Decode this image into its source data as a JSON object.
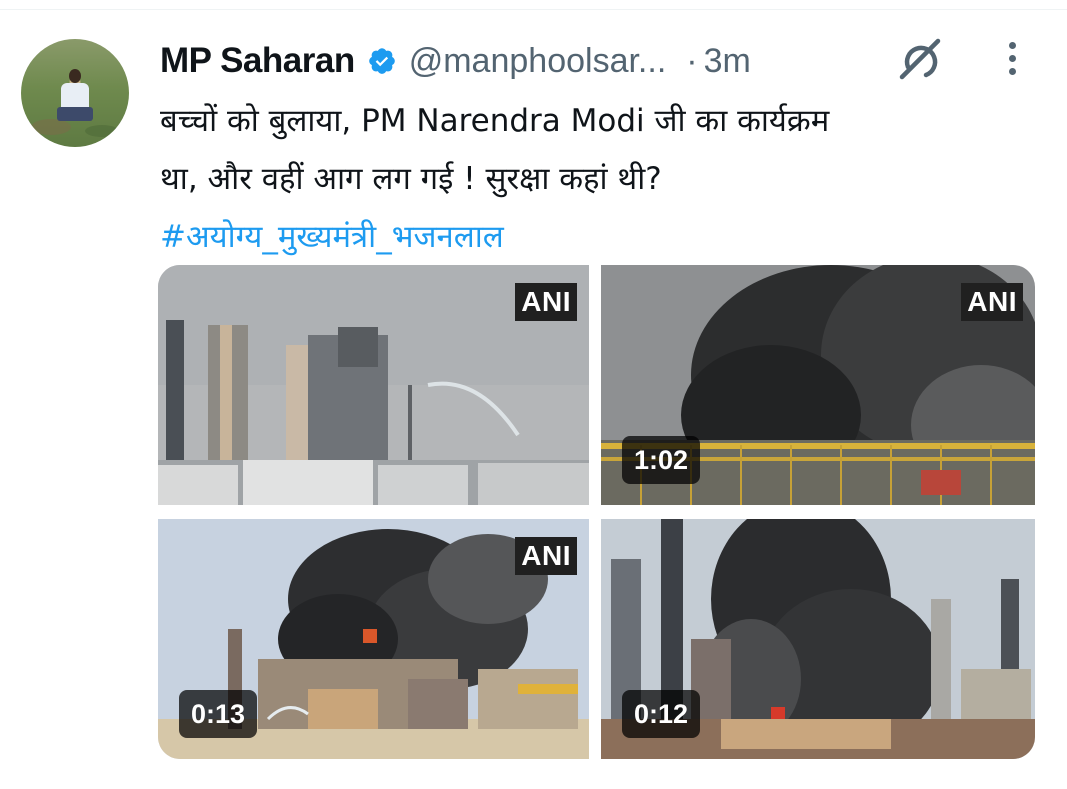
{
  "tweet": {
    "author_name": "MP Saharan",
    "handle": "@manphoolsar...",
    "separator": "·",
    "time": "3m",
    "text_line1": "बच्चों को बुलाया, PM Narendra Modi जी का कार्यक्रम",
    "text_line2": "था, और वहीं आग लग गई !   सुरक्षा कहां थी?",
    "hashtag": "#अयोग्य_मुख्यमंत्री_भजनलाल"
  },
  "icons": {
    "verified": "verified-badge-icon",
    "grok": "grok-icon",
    "more": "more-options-icon"
  },
  "media": [
    {
      "watermark": "ANI",
      "duration": ""
    },
    {
      "watermark": "ANI",
      "duration": "1:02"
    },
    {
      "watermark": "ANI",
      "duration": "0:13"
    },
    {
      "watermark": "",
      "duration": "0:12"
    }
  ],
  "colors": {
    "text": "#0f1419",
    "secondary": "#536471",
    "link": "#1d9bf0",
    "verified": "#1d9bf0"
  }
}
